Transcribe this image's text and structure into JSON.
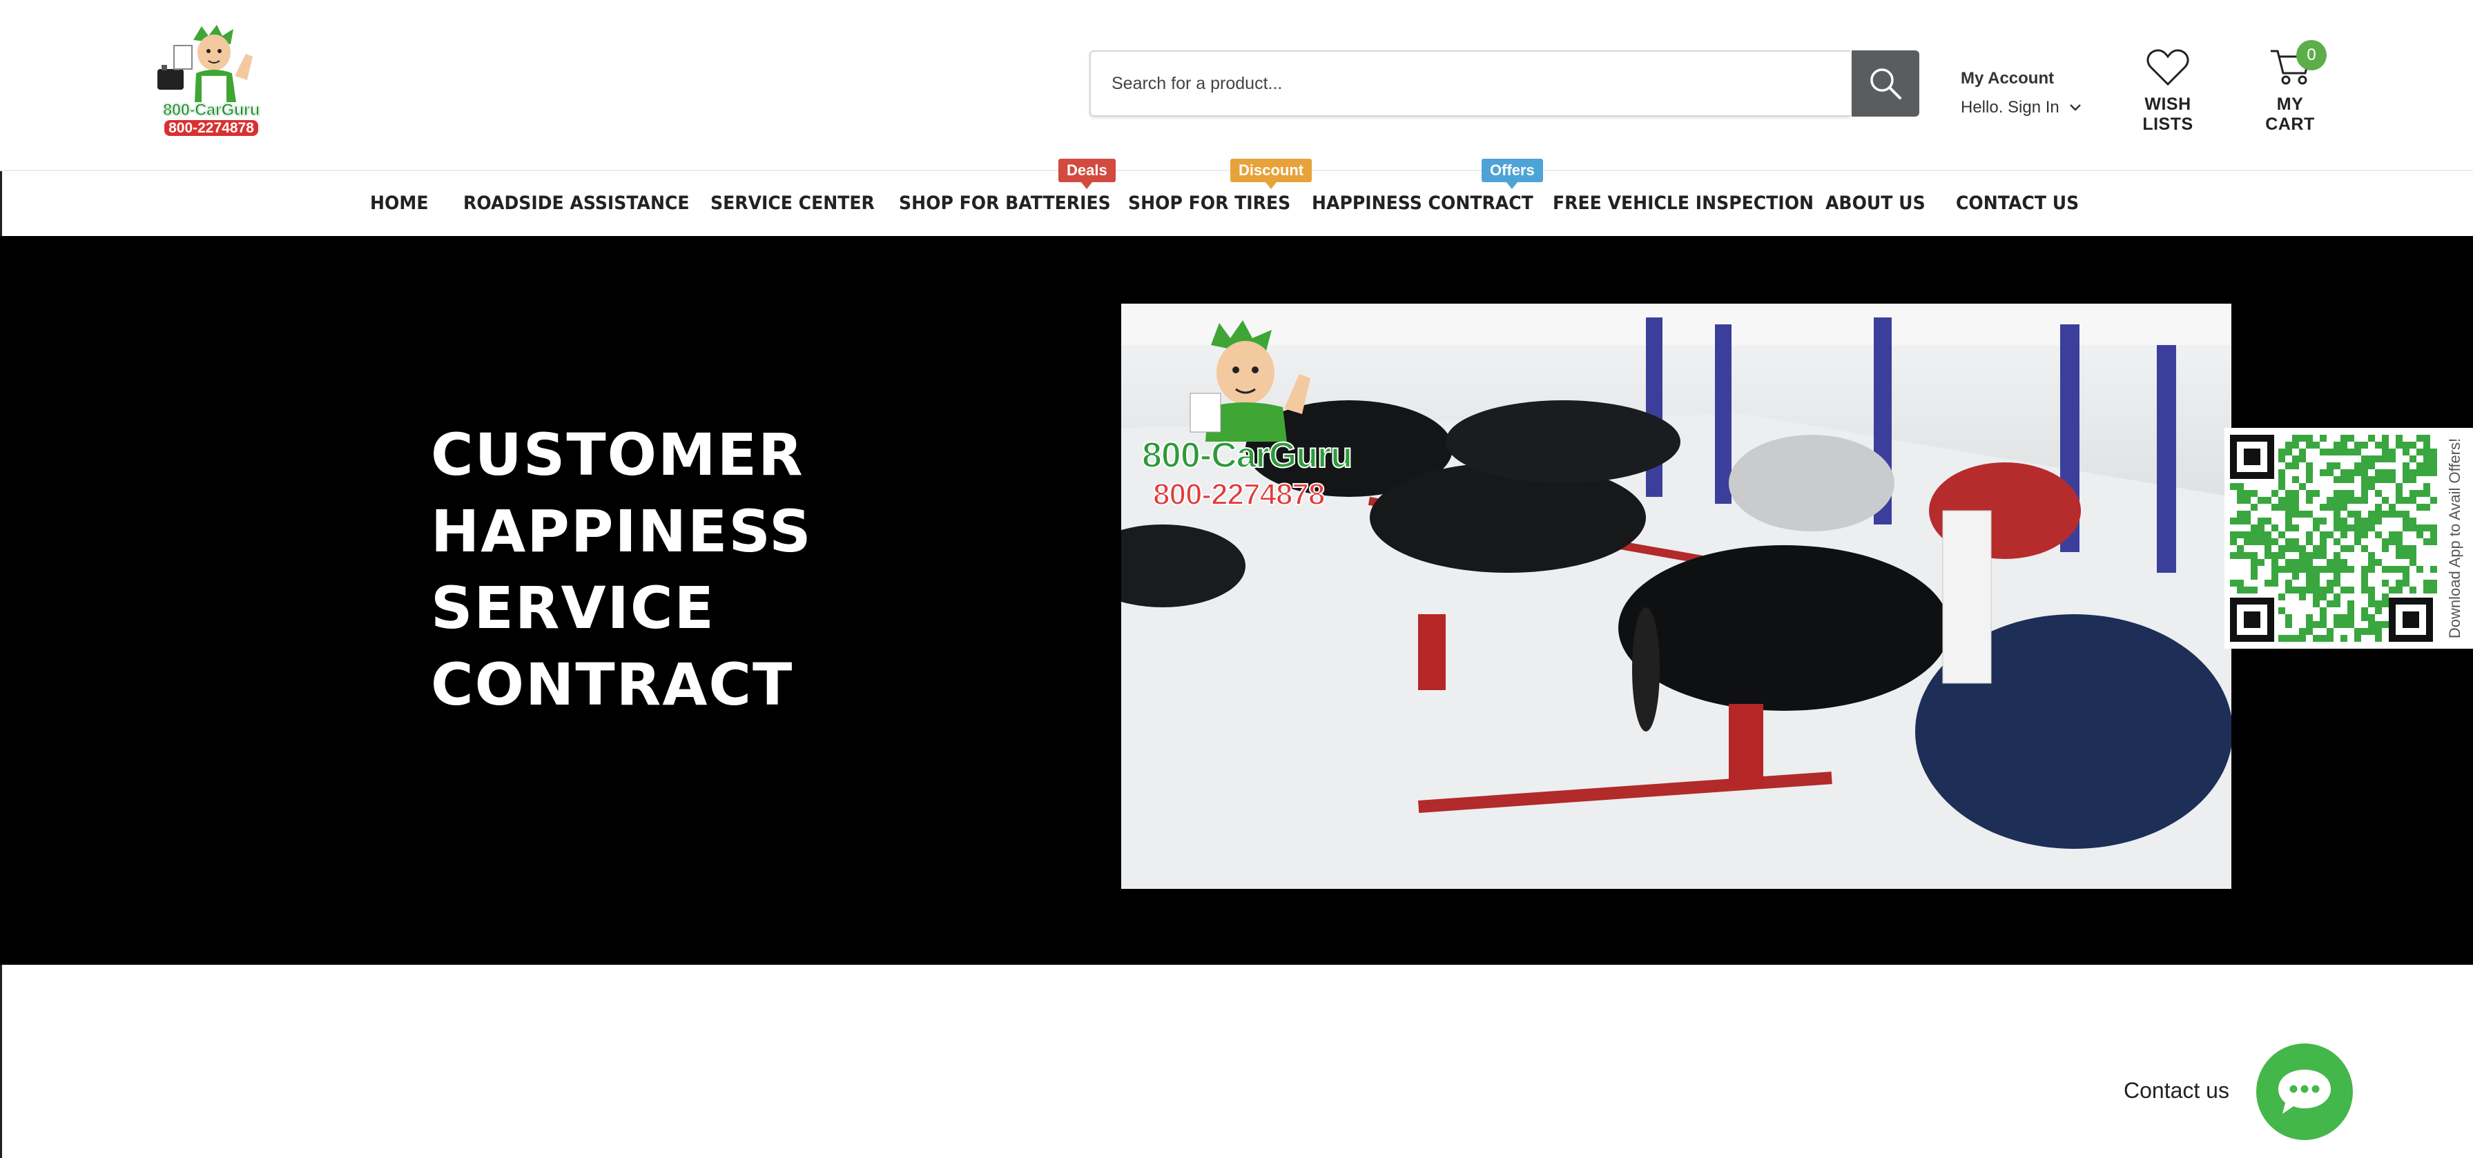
{
  "header": {
    "logo": {
      "brand": "800-CarGuru",
      "phone": "800-2274878"
    },
    "search": {
      "placeholder": "Search for a product..."
    },
    "account": {
      "title": "My Account",
      "greeting": "Hello. Sign In"
    },
    "wishlist": {
      "label": "WISH LISTS"
    },
    "cart": {
      "label": "MY CART",
      "count": "0"
    }
  },
  "nav": {
    "items": [
      {
        "label": "HOME"
      },
      {
        "label": "ROADSIDE ASSISTANCE"
      },
      {
        "label": "SERVICE CENTER"
      },
      {
        "label": "SHOP FOR BATTERIES",
        "tag": "Deals"
      },
      {
        "label": "SHOP FOR TIRES",
        "tag": "Discount"
      },
      {
        "label": "HAPPINESS CONTRACT",
        "tag": "Offers"
      },
      {
        "label": "FREE VEHICLE INSPECTION"
      },
      {
        "label": "ABOUT US"
      },
      {
        "label": "CONTACT US"
      }
    ],
    "tag_colors": {
      "Deals": "#d34a3f",
      "Discount": "#e8a23a",
      "Offers": "#4ea3d6"
    }
  },
  "hero": {
    "title_lines": [
      "CUSTOMER",
      "HAPPINESS",
      "SERVICE",
      "CONTRACT"
    ],
    "video_overlay": {
      "brand": "800-CarGuru",
      "phone": "800-2274878"
    },
    "qr_caption": "Download App to Avail Offers!"
  },
  "footer": {
    "contact_label": "Contact us"
  },
  "colors": {
    "hero_bg": "#000000",
    "chat_button": "#44b74a",
    "cart_badge": "#5cae4b",
    "search_button": "#5a5d60"
  }
}
